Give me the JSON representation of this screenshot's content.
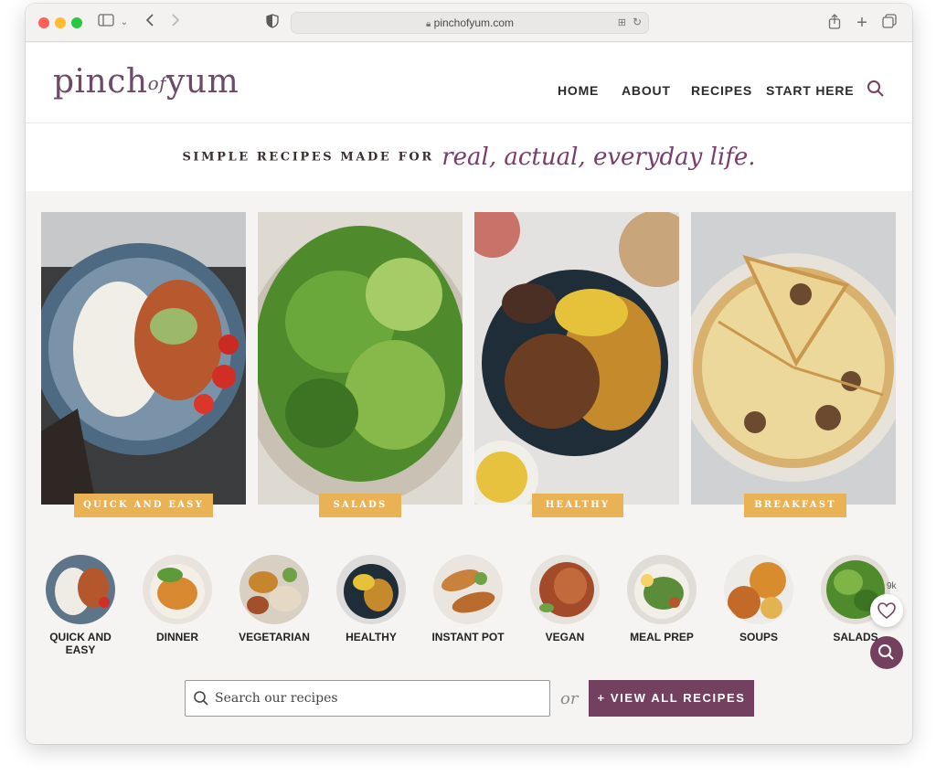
{
  "browser": {
    "url": "pinchofyum.com"
  },
  "site": {
    "logo": {
      "part1": "pinch",
      "part2": "of",
      "part3": "yum"
    },
    "nav": [
      "HOME",
      "ABOUT",
      "RECIPES",
      "START HERE"
    ],
    "tagline": {
      "plain": "SIMPLE RECIPES MADE FOR",
      "script": "real, actual, everyday life."
    }
  },
  "categories": [
    {
      "label": "QUICK AND EASY"
    },
    {
      "label": "SALADS"
    },
    {
      "label": "HEALTHY"
    },
    {
      "label": "BREAKFAST"
    }
  ],
  "circles": [
    {
      "label": "QUICK AND EASY"
    },
    {
      "label": "DINNER"
    },
    {
      "label": "VEGETARIAN"
    },
    {
      "label": "HEALTHY"
    },
    {
      "label": "INSTANT POT"
    },
    {
      "label": "VEGAN"
    },
    {
      "label": "MEAL PREP"
    },
    {
      "label": "SOUPS"
    },
    {
      "label": "SALADS"
    }
  ],
  "search": {
    "placeholder": "Search our recipes",
    "or_label": "or",
    "view_all_label": "+ VIEW ALL RECIPES"
  },
  "floating": {
    "save_count": "9k"
  },
  "colors": {
    "brand": "#74405f",
    "label_gold": "#e8b255"
  }
}
